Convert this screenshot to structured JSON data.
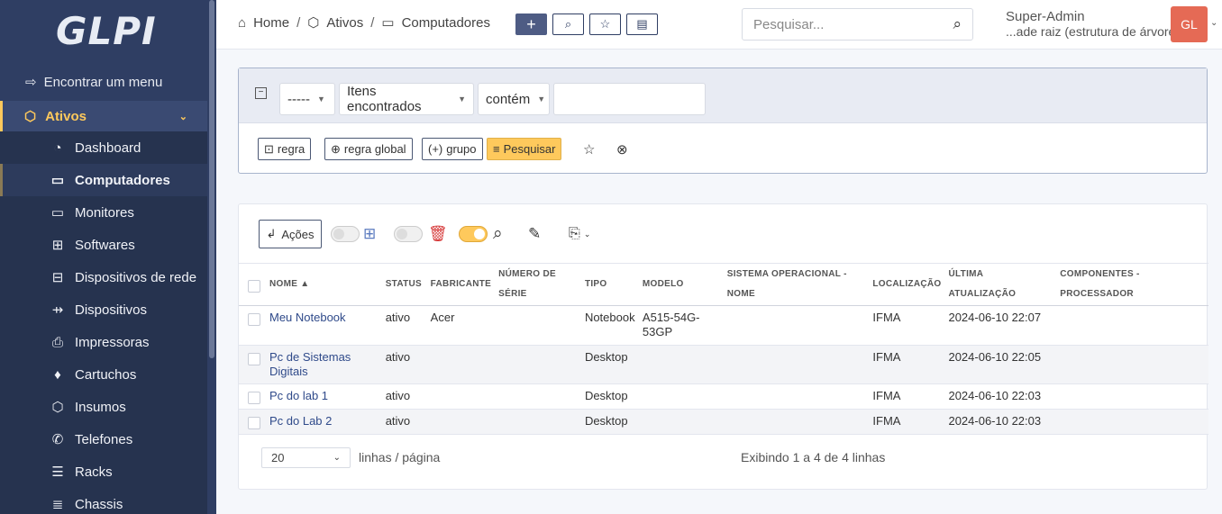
{
  "app": {
    "logo_text": "GLPI"
  },
  "sidebar": {
    "find_menu": "Encontrar um menu",
    "section": "Ativos",
    "items": [
      {
        "label": "Dashboard",
        "icon": "gauge-icon"
      },
      {
        "label": "Computadores",
        "icon": "laptop-icon"
      },
      {
        "label": "Monitores",
        "icon": "monitor-icon"
      },
      {
        "label": "Softwares",
        "icon": "apps-icon"
      },
      {
        "label": "Dispositivos de rede",
        "icon": "network-icon"
      },
      {
        "label": "Dispositivos",
        "icon": "usb-icon"
      },
      {
        "label": "Impressoras",
        "icon": "printer-icon"
      },
      {
        "label": "Cartuchos",
        "icon": "droplet-icon"
      },
      {
        "label": "Insumos",
        "icon": "box-icon"
      },
      {
        "label": "Telefones",
        "icon": "phone-icon"
      },
      {
        "label": "Racks",
        "icon": "server-icon"
      },
      {
        "label": "Chassis",
        "icon": "chassis-icon"
      }
    ],
    "active_index": 1
  },
  "header": {
    "breadcrumb": [
      "Home",
      "Ativos",
      "Computadores"
    ],
    "search_placeholder": "Pesquisar...",
    "user_name": "Super-Admin",
    "user_entity": "...ade raiz (estrutura de árvore)",
    "avatar_initials": "GL"
  },
  "criteria": {
    "field_select": "-----",
    "items_select": "Itens encontrados",
    "op_select": "contém",
    "value": "",
    "btn_rule": "regra",
    "btn_global_rule": "regra global",
    "btn_group": "grupo",
    "btn_search": "Pesquisar"
  },
  "results": {
    "actions_label": "Ações",
    "columns": [
      "NOME",
      "STATUS",
      "FABRICANTE",
      "NÚMERO DE SÉRIE",
      "TIPO",
      "MODELO",
      "SISTEMA OPERACIONAL - NOME",
      "LOCALIZAÇÃO",
      "ÚLTIMA ATUALIZAÇÃO",
      "COMPONENTES - PROCESSADOR"
    ],
    "rows": [
      {
        "name": "Meu Notebook",
        "status": "ativo",
        "manufacturer": "Acer",
        "serial": "",
        "type": "Notebook",
        "model": "A515-54G-53GP",
        "os": "",
        "location": "IFMA",
        "updated": "2024-06-10 22:07",
        "cpu": ""
      },
      {
        "name": "Pc de Sistemas Digitais",
        "status": "ativo",
        "manufacturer": "",
        "serial": "",
        "type": "Desktop",
        "model": "",
        "os": "",
        "location": "IFMA",
        "updated": "2024-06-10 22:05",
        "cpu": ""
      },
      {
        "name": "Pc do lab 1",
        "status": "ativo",
        "manufacturer": "",
        "serial": "",
        "type": "Desktop",
        "model": "",
        "os": "",
        "location": "IFMA",
        "updated": "2024-06-10 22:03",
        "cpu": ""
      },
      {
        "name": "Pc do Lab 2",
        "status": "ativo",
        "manufacturer": "",
        "serial": "",
        "type": "Desktop",
        "model": "",
        "os": "",
        "location": "IFMA",
        "updated": "2024-06-10 22:03",
        "cpu": ""
      }
    ],
    "page_size": "20",
    "page_size_label": "linhas / página",
    "showing": "Exibindo 1 a 4 de 4 linhas"
  },
  "colors": {
    "sidebar": "#2f3e63",
    "accent": "#fec95c",
    "avatar": "#e56a55"
  }
}
